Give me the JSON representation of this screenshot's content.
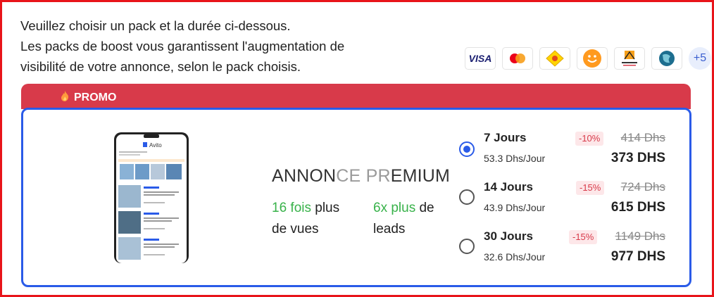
{
  "intro": {
    "line1": "Veuillez choisir un pack et la durée ci-dessous.",
    "line2": "Les packs de boost vous garantissent l'augmentation de",
    "line3": "visibilité de votre annonce, selon le pack choisis."
  },
  "payments": {
    "visa": "VISA",
    "mastercard": "mastercard-icon",
    "other_icons": [
      "postal-icon",
      "smiley-icon",
      "attijari-icon",
      "globe-icon"
    ],
    "more_count": "+5"
  },
  "promo": {
    "label": "PROMO",
    "color": "#d83a4a"
  },
  "accent_color": "#2a5be8",
  "phone_screen": {
    "app_name": "Avito"
  },
  "pack": {
    "title_part1": "ANNON",
    "title_part2": "CE ",
    "title_part3": "PR",
    "title_part4": "EMIUM",
    "stat1_highlight": "16 fois",
    "stat1_rest1": " plus",
    "stat1_rest2": "de vues",
    "stat2_highlight": "6x plus",
    "stat2_rest1": " de",
    "stat2_rest2": "leads"
  },
  "options": [
    {
      "duration": "7 Jours",
      "per_day": "53.3 Dhs/Jour",
      "discount": "-10%",
      "old_price": "414 Dhs",
      "new_price": "373 DHS",
      "selected": true
    },
    {
      "duration": "14 Jours",
      "per_day": "43.9 Dhs/Jour",
      "discount": "-15%",
      "old_price": "724 Dhs",
      "new_price": "615 DHS",
      "selected": false
    },
    {
      "duration": "30 Jours",
      "per_day": "32.6 Dhs/Jour",
      "discount": "-15%",
      "old_price": "1149 Dhs",
      "new_price": "977 DHS",
      "selected": false
    }
  ]
}
